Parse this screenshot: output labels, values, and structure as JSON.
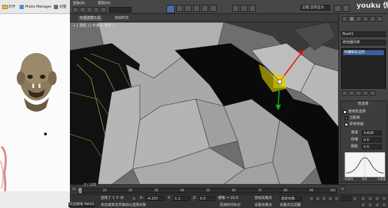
{
  "viewer": {
    "toolbar": {
      "open_label": "打开",
      "photo_manager_label": "Photo Manager",
      "extra_label": "完整"
    }
  },
  "topbar": {
    "menu_item_1": "渲染(R)",
    "menu_item_2": "帮助(H)",
    "ribbon_tab_1": "石墨建模工具",
    "ribbon_tab_2": "自由形式",
    "dropdown_value": "边模 选项显示",
    "watermark": "youku 优酷"
  },
  "viewport": {
    "label": "+ [ 透视 ] [ 平滑 + 高光 ]"
  },
  "cmdpanel": {
    "object_name": "Box01",
    "modifier_list": "修改器列表",
    "stack_item": "可编辑多边形",
    "rollout_title": "软选择",
    "use_soft_selection": "使用软选择",
    "edge_distance": "边距离",
    "affect_backfacing": "影响背面",
    "falloff_label": "衰减",
    "falloff_value": "4.828",
    "pinch_label": "收缩",
    "pinch_value": "0.0",
    "bubble_label": "膨胀",
    "bubble_value": "0.0",
    "curve_label_left": "-4.828",
    "curve_label_mid": "0.0",
    "curve_label_right": "4.828"
  },
  "timeline": {
    "frame_display": "0 / 100",
    "ticks": [
      "0",
      "10",
      "20",
      "30",
      "40",
      "50",
      "60",
      "70",
      "80",
      "90",
      "100"
    ]
  },
  "status": {
    "welcome": "欢迎使用 MAXS",
    "selection_info": "选择了 1 个 对",
    "prompt": "单击或单击并拖动以选择对象",
    "x_label": "X:",
    "x_value": "-4.237",
    "y_label": "Y:",
    "y_value": "1.1",
    "z_label": "Z:",
    "z_value": "0.0",
    "grid_label": "栅格 = 10.0",
    "add_time_tag": "添加时间标记",
    "autokey": "自动关键点",
    "selected_obj": "选定对象",
    "set_key": "设置关键点",
    "key_filter": "关键点过滤器"
  },
  "colors": {
    "viewport_bg": "#6e6e6e",
    "mesh_face": "#a8a8a8",
    "mesh_shadow": "#0a0a0a",
    "gizmo_red": "#e01010",
    "gizmo_green": "#10b010",
    "gizmo_blue": "#1030d0",
    "highlight_yellow": "#e8d000"
  }
}
